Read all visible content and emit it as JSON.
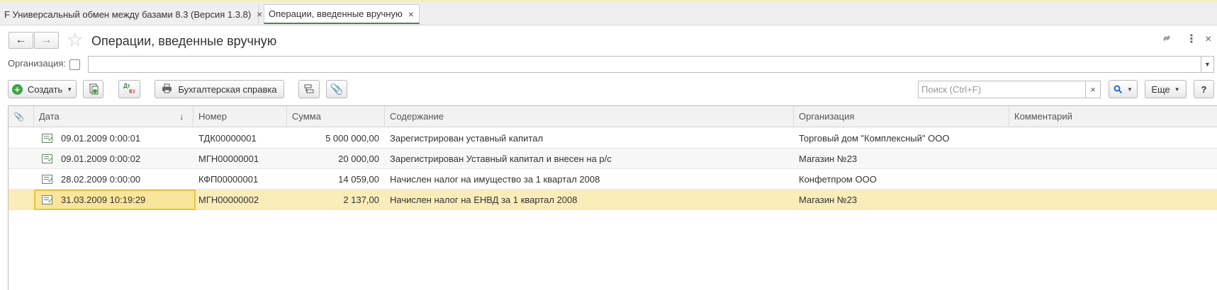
{
  "tabs": [
    {
      "label": "F Универсальный обмен между базами 8.3 (Версия 1.3.8)",
      "active": false
    },
    {
      "label": "Операции, введенные вручную",
      "active": true
    }
  ],
  "window": {
    "title": "Операции, введенные вручную"
  },
  "filter": {
    "org_label": "Организация:",
    "org_value": ""
  },
  "toolbar": {
    "create_label": "Создать",
    "report_label": "Бухгалтерская справка",
    "search_placeholder": "Поиск (Ctrl+F)",
    "more_label": "Еще",
    "help_label": "?",
    "dt_kt_top": "Дт",
    "dt_kt_bottom": "Кт"
  },
  "table": {
    "columns": [
      "Дата",
      "Номер",
      "Сумма",
      "Содержание",
      "Организация",
      "Комментарий"
    ],
    "sort_indicator": "↓",
    "rows": [
      {
        "date": "09.01.2009 0:00:01",
        "number": "ТДК00000001",
        "sum": "5 000 000,00",
        "content": "Зарегистрирован уставный капитал",
        "org": "Торговый дом \"Комплексный\" ООО",
        "comment": ""
      },
      {
        "date": "09.01.2009 0:00:02",
        "number": "МГН00000001",
        "sum": "20 000,00",
        "content": "Зарегистрирован Уставный капитал и внесен на р/с",
        "org": "Магазин №23",
        "comment": ""
      },
      {
        "date": "28.02.2009 0:00:00",
        "number": "КФП00000001",
        "sum": "14 059,00",
        "content": "Начислен налог на имущество за 1 квартал 2008",
        "org": "Конфетпром ООО",
        "comment": ""
      },
      {
        "date": "31.03.2009 10:19:29",
        "number": "МГН00000002",
        "sum": "2 137,00",
        "content": "Начислен налог на ЕНВД за 1 квартал 2008",
        "org": "Магазин №23",
        "comment": "",
        "selected": true
      }
    ]
  },
  "colors": {
    "accent_green": "#3f8b46",
    "selection": "#fbedba",
    "current_cell": "#fae59d"
  }
}
